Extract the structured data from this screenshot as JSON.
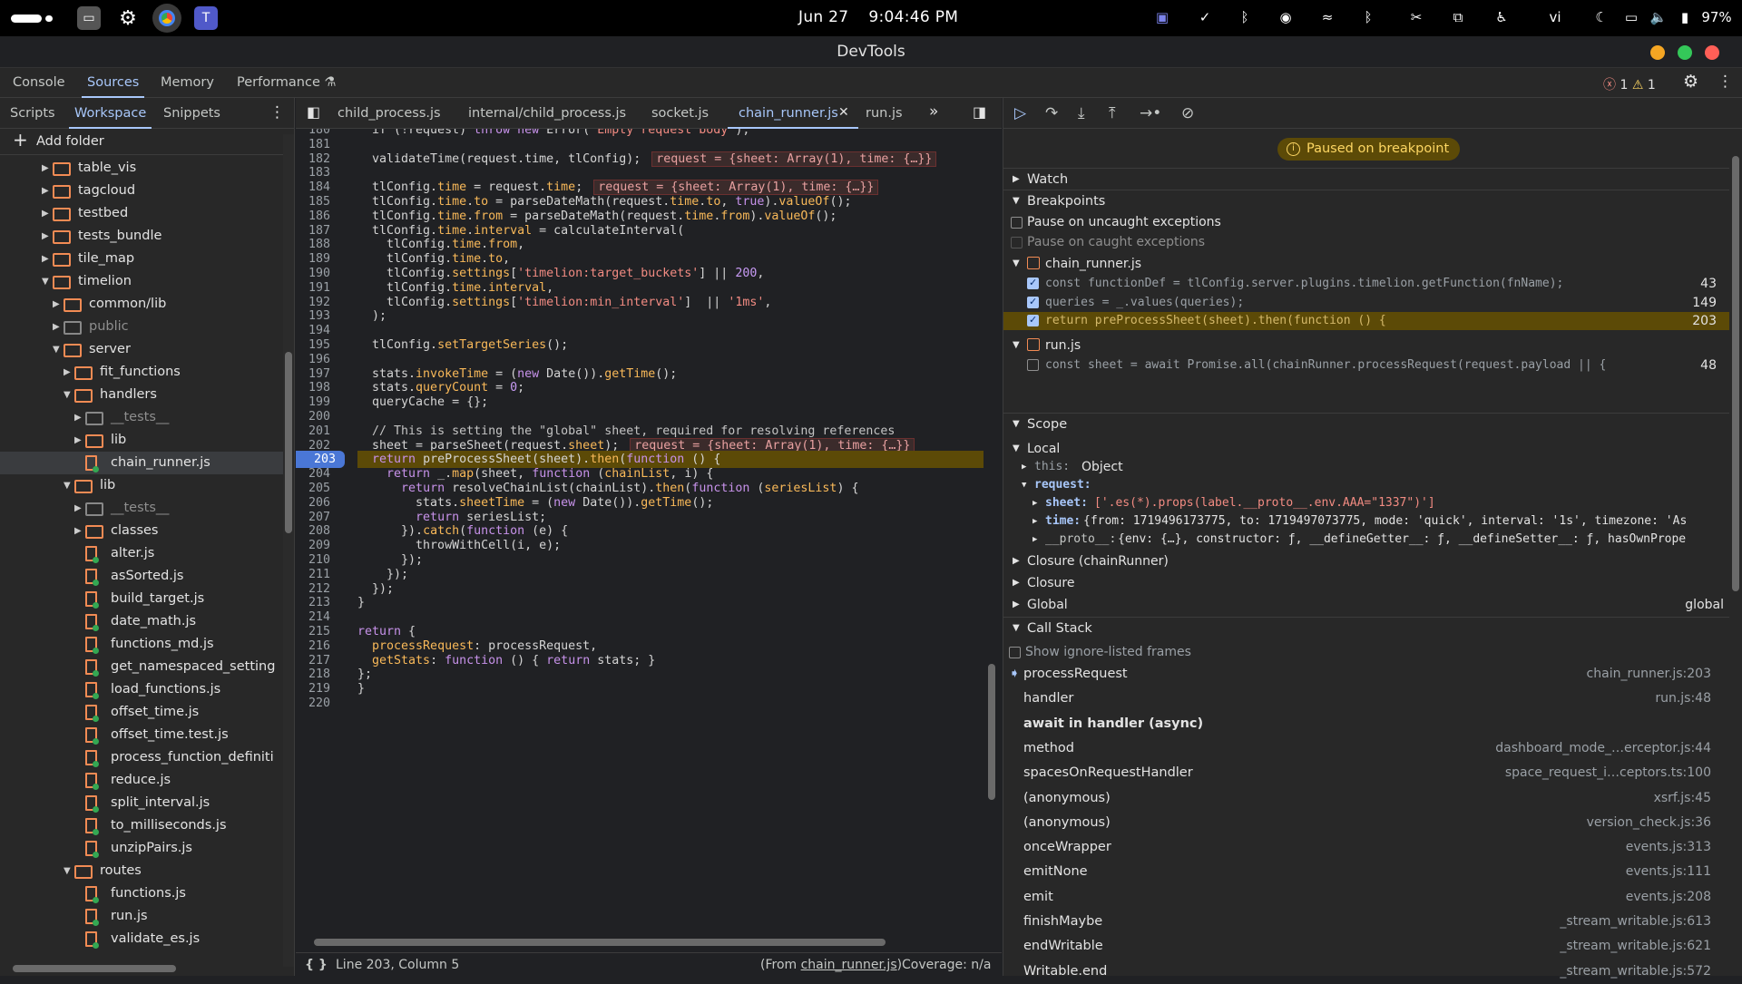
{
  "system_bar": {
    "date": "Jun 27",
    "time": "9:04:46 PM",
    "battery": "97%",
    "lang": "vi"
  },
  "window": {
    "title": "DevTools"
  },
  "main_tabs": [
    "Console",
    "Sources",
    "Memory",
    "Performance"
  ],
  "main_tabs_active": "Sources",
  "errors": "1",
  "warnings": "1",
  "left_tabs": [
    "Scripts",
    "Workspace",
    "Snippets"
  ],
  "add_folder": "Add folder",
  "tree": [
    {
      "label": "table_vis",
      "type": "folder",
      "indent": 0,
      "open": false
    },
    {
      "label": "tagcloud",
      "type": "folder",
      "indent": 0,
      "open": false
    },
    {
      "label": "testbed",
      "type": "folder",
      "indent": 0,
      "open": false
    },
    {
      "label": "tests_bundle",
      "type": "folder",
      "indent": 0,
      "open": false
    },
    {
      "label": "tile_map",
      "type": "folder",
      "indent": 0,
      "open": false
    },
    {
      "label": "timelion",
      "type": "folder",
      "indent": 0,
      "open": true
    },
    {
      "label": "common/lib",
      "type": "folder",
      "indent": 1,
      "open": false
    },
    {
      "label": "public",
      "type": "folder",
      "indent": 1,
      "open": false,
      "dim": true
    },
    {
      "label": "server",
      "type": "folder",
      "indent": 1,
      "open": true
    },
    {
      "label": "fit_functions",
      "type": "folder",
      "indent": 2,
      "open": false
    },
    {
      "label": "handlers",
      "type": "folder",
      "indent": 2,
      "open": true
    },
    {
      "label": "__tests__",
      "type": "folder",
      "indent": 3,
      "open": false,
      "dim": true
    },
    {
      "label": "lib",
      "type": "folder",
      "indent": 3,
      "open": false
    },
    {
      "label": "chain_runner.js",
      "type": "file",
      "indent": 3,
      "selected": true
    },
    {
      "label": "lib",
      "type": "folder",
      "indent": 2,
      "open": true
    },
    {
      "label": "__tests__",
      "type": "folder",
      "indent": 3,
      "open": false,
      "dim": true
    },
    {
      "label": "classes",
      "type": "folder",
      "indent": 3,
      "open": false
    },
    {
      "label": "alter.js",
      "type": "file",
      "indent": 3
    },
    {
      "label": "asSorted.js",
      "type": "file",
      "indent": 3
    },
    {
      "label": "build_target.js",
      "type": "file",
      "indent": 3
    },
    {
      "label": "date_math.js",
      "type": "file",
      "indent": 3
    },
    {
      "label": "functions_md.js",
      "type": "file",
      "indent": 3
    },
    {
      "label": "get_namespaced_setting",
      "type": "file",
      "indent": 3
    },
    {
      "label": "load_functions.js",
      "type": "file",
      "indent": 3
    },
    {
      "label": "offset_time.js",
      "type": "file",
      "indent": 3
    },
    {
      "label": "offset_time.test.js",
      "type": "file",
      "indent": 3
    },
    {
      "label": "process_function_definiti",
      "type": "file",
      "indent": 3
    },
    {
      "label": "reduce.js",
      "type": "file",
      "indent": 3
    },
    {
      "label": "split_interval.js",
      "type": "file",
      "indent": 3
    },
    {
      "label": "to_milliseconds.js",
      "type": "file",
      "indent": 3
    },
    {
      "label": "unzipPairs.js",
      "type": "file",
      "indent": 3
    },
    {
      "label": "routes",
      "type": "folder",
      "indent": 2,
      "open": true
    },
    {
      "label": "functions.js",
      "type": "file",
      "indent": 3
    },
    {
      "label": "run.js",
      "type": "file",
      "indent": 3
    },
    {
      "label": "validate_es.js",
      "type": "file",
      "indent": 3
    }
  ],
  "file_tabs": [
    "child_process.js",
    "internal/child_process.js",
    "socket.js",
    "chain_runner.js",
    "run.js"
  ],
  "active_file_tab": "chain_runner.js",
  "code_lines": [
    {
      "n": "180",
      "html": "if (!request) <span class='k'>throw new</span> Error(<span class='s'>'Empty request body'</span>);"
    },
    {
      "n": "181",
      "html": ""
    },
    {
      "n": "182",
      "html": "validateTime(request.time, tlConfig);",
      "ins": "request = {sheet: Array(1), time: {…}}"
    },
    {
      "n": "183",
      "html": ""
    },
    {
      "n": "184",
      "html": "tlConfig.<span class='p'>time</span> = request.<span class='p'>time</span>;",
      "ins": "request = {sheet: Array(1), time: {…}}"
    },
    {
      "n": "185",
      "html": "tlConfig.<span class='p'>time</span>.<span class='p'>to</span> = parseDateMath(request.<span class='p'>time</span>.<span class='p'>to</span>, <span class='k'>true</span>).<span class='p'>valueOf</span>();"
    },
    {
      "n": "186",
      "html": "tlConfig.<span class='p'>time</span>.<span class='p'>from</span> = parseDateMath(request.<span class='p'>time</span>.<span class='p'>from</span>).<span class='p'>valueOf</span>();"
    },
    {
      "n": "187",
      "html": "tlConfig.<span class='p'>time</span>.<span class='p'>interval</span> = calculateInterval("
    },
    {
      "n": "188",
      "html": "  tlConfig.<span class='p'>time</span>.<span class='p'>from</span>,"
    },
    {
      "n": "189",
      "html": "  tlConfig.<span class='p'>time</span>.<span class='p'>to</span>,"
    },
    {
      "n": "190",
      "html": "  tlConfig.<span class='p'>settings</span>[<span class='s'>'timelion:target_buckets'</span>] || <span class='n'>200</span>,"
    },
    {
      "n": "191",
      "html": "  tlConfig.<span class='p'>time</span>.<span class='p'>interval</span>,"
    },
    {
      "n": "192",
      "html": "  tlConfig.<span class='p'>settings</span>[<span class='s'>'timelion:min_interval'</span>]  || <span class='s'>'1ms'</span>,"
    },
    {
      "n": "193",
      "html": ");"
    },
    {
      "n": "194",
      "html": ""
    },
    {
      "n": "195",
      "html": "tlConfig.<span class='p'>setTargetSeries</span>();"
    },
    {
      "n": "196",
      "html": ""
    },
    {
      "n": "197",
      "html": "stats.<span class='p'>invokeTime</span> = (<span class='k'>new</span> Date()).<span class='p'>getTime</span>();"
    },
    {
      "n": "198",
      "html": "stats.<span class='p'>queryCount</span> = <span class='n'>0</span>;"
    },
    {
      "n": "199",
      "html": "queryCache = {};"
    },
    {
      "n": "200",
      "html": ""
    },
    {
      "n": "201",
      "html": "<span class='cm'>// This is setting the \"global\" sheet, required for resolving references</span>"
    },
    {
      "n": "202",
      "html": "sheet = parseSheet(request.<span class='p'>sheet</span>);",
      "ins": "request = {sheet: Array(1), time: {…}}"
    },
    {
      "n": "203",
      "html": "<span class='k'>return</span> preProcessSheet(sheet).<span class='p'>then</span>(<span class='k'>function</span> () {",
      "bp": true
    },
    {
      "n": "204",
      "html": "  <span class='k'>return</span> _.<span class='p'>map</span>(sheet, <span class='k'>function</span> (<span class='p'>chainList</span>, i) {"
    },
    {
      "n": "205",
      "html": "    <span class='k'>return</span> resolveChainList(chainList).<span class='p'>then</span>(<span class='k'>function</span> (<span class='p'>seriesList</span>) {"
    },
    {
      "n": "206",
      "html": "      stats.<span class='p'>sheetTime</span> = (<span class='k'>new</span> Date()).<span class='p'>getTime</span>();"
    },
    {
      "n": "207",
      "html": "      <span class='k'>return</span> seriesList;"
    },
    {
      "n": "208",
      "html": "    }).<span class='p'>catch</span>(<span class='k'>function</span> (e) {"
    },
    {
      "n": "209",
      "html": "      throwWithCell(i, e);"
    },
    {
      "n": "210",
      "html": "    });"
    },
    {
      "n": "211",
      "html": "  });"
    },
    {
      "n": "212",
      "html": "});"
    },
    {
      "n": "213",
      "html": "}"
    },
    {
      "n": "214",
      "html": ""
    },
    {
      "n": "215",
      "html": "<span class='k'>return</span> {"
    },
    {
      "n": "216",
      "html": "  <span class='p'>processRequest</span>: processRequest,"
    },
    {
      "n": "217",
      "html": "  <span class='p'>getStats</span>: <span class='k'>function</span> () { <span class='k'>return</span> stats; }"
    },
    {
      "n": "218",
      "html": "};"
    },
    {
      "n": "219",
      "html": "}"
    },
    {
      "n": "220",
      "html": ""
    }
  ],
  "status": {
    "position": "Line 203, Column 5",
    "from_prefix": "(From ",
    "from_file": "chain_runner.js",
    "from_suffix": ")",
    "coverage": "Coverage: n/a"
  },
  "paused": "Paused on breakpoint",
  "sections": {
    "watch": "Watch",
    "breakpoints": "Breakpoints",
    "scope": "Scope",
    "call_stack": "Call Stack"
  },
  "pause_uncaught": "Pause on uncaught exceptions",
  "pause_caught": "Pause on caught exceptions",
  "bp_files": [
    {
      "file": "chain_runner.js",
      "items": [
        {
          "code": "const functionDef = tlConfig.server.plugins.timelion.getFunction(fnName);",
          "line": "43",
          "checked": true
        },
        {
          "code": "queries = _.values(queries);",
          "line": "149",
          "checked": true
        },
        {
          "code": "return preProcessSheet(sheet).then(function () {",
          "line": "203",
          "checked": true,
          "active": true
        }
      ]
    },
    {
      "file": "run.js",
      "items": [
        {
          "code": "const sheet = await Promise.all(chainRunner.processRequest(request.payload || {",
          "line": "48",
          "checked": false
        }
      ]
    }
  ],
  "scope": {
    "local": "Local",
    "this_key": "this:",
    "this_val": "Object",
    "request_key": "request:",
    "sheet_key": "sheet:",
    "sheet_val": "['.es(*).props(label.__proto__.env.AAA=\"1337\")']",
    "time_key": "time:",
    "time_val": "{from: 1719496173775, to: 1719497073775, mode: 'quick', interval: '1s', timezone: 'As",
    "proto_key": "__proto__:",
    "proto_val": "{env: {…}, constructor: ƒ, __defineGetter__: ƒ, __defineSetter__: ƒ, hasOwnPrope",
    "closure1": "Closure (chainRunner)",
    "closure2": "Closure",
    "global": "Global",
    "global_val": "global"
  },
  "show_ignore": "Show ignore-listed frames",
  "call_stack": [
    {
      "fn": "processRequest",
      "loc": "chain_runner.js:203",
      "current": true
    },
    {
      "fn": "handler",
      "loc": "run.js:48"
    },
    {
      "fn": "await in handler (async)",
      "loc": "",
      "async": true
    },
    {
      "fn": "method",
      "loc": "dashboard_mode_…erceptor.js:44"
    },
    {
      "fn": "spacesOnRequestHandler",
      "loc": "space_request_i…ceptors.ts:100"
    },
    {
      "fn": "(anonymous)",
      "loc": "xsrf.js:45"
    },
    {
      "fn": "(anonymous)",
      "loc": "version_check.js:36"
    },
    {
      "fn": "onceWrapper",
      "loc": "events.js:313"
    },
    {
      "fn": "emitNone",
      "loc": "events.js:111"
    },
    {
      "fn": "emit",
      "loc": "events.js:208"
    },
    {
      "fn": "finishMaybe",
      "loc": "_stream_writable.js:613"
    },
    {
      "fn": "endWritable",
      "loc": "_stream_writable.js:621"
    },
    {
      "fn": "Writable.end",
      "loc": "_stream_writable.js:572"
    }
  ],
  "colors": {
    "accent": "#a8c7fa",
    "paused_bg": "#5c4a07",
    "folder": "#f28b54",
    "breakpoint": "#4a77d6"
  }
}
